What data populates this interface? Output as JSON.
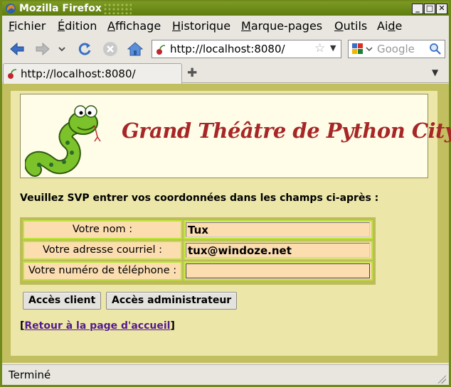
{
  "window": {
    "title": "Mozilla Firefox",
    "controls": [
      "minimize",
      "maximize",
      "close"
    ]
  },
  "menu": {
    "items": [
      {
        "label": "Fichier",
        "accel": "F"
      },
      {
        "label": "Édition",
        "accel": "É"
      },
      {
        "label": "Affichage",
        "accel": "A"
      },
      {
        "label": "Historique",
        "accel": "H"
      },
      {
        "label": "Marque-pages",
        "accel": "M"
      },
      {
        "label": "Outils",
        "accel": "O"
      },
      {
        "label": "Aide",
        "accel": "d"
      }
    ]
  },
  "nav": {
    "icons": [
      "back-arrow-icon",
      "forward-arrow-icon",
      "history-dropdown-icon",
      "reload-icon",
      "stop-icon",
      "home-icon"
    ],
    "url": "http://localhost:8080/",
    "search_placeholder": "Google"
  },
  "tabs": [
    {
      "label": "http://localhost:8080/",
      "active": true
    }
  ],
  "page": {
    "banner_title": "Grand Théâtre de Python City",
    "intro": "Veuillez SVP entrer vos coordonnées dans les champs ci-après :",
    "form": {
      "rows": [
        {
          "label": "Votre nom :",
          "value": ""
        },
        {
          "label": "Votre adresse courriel :",
          "value": ""
        },
        {
          "label": "Votre numéro de téléphone :",
          "value": ""
        }
      ],
      "name_value": "Tux",
      "email_value": "tux@windoze.net",
      "phone_value": ""
    },
    "buttons": {
      "client": "Accès client",
      "admin": "Accès administrateur"
    },
    "back_link": {
      "prefix": "[",
      "text": "Retour à la page d'accueil",
      "suffix": "]"
    }
  },
  "status": {
    "text": "Terminé"
  },
  "colors": {
    "titlebar": "#6f8a1a",
    "page_bg": "#ece7a9",
    "frame_bg": "#c2bf60",
    "banner_title": "#a72727",
    "form_cell": "#fbddb0",
    "form_border": "#bde43a",
    "link": "#551a8b"
  }
}
